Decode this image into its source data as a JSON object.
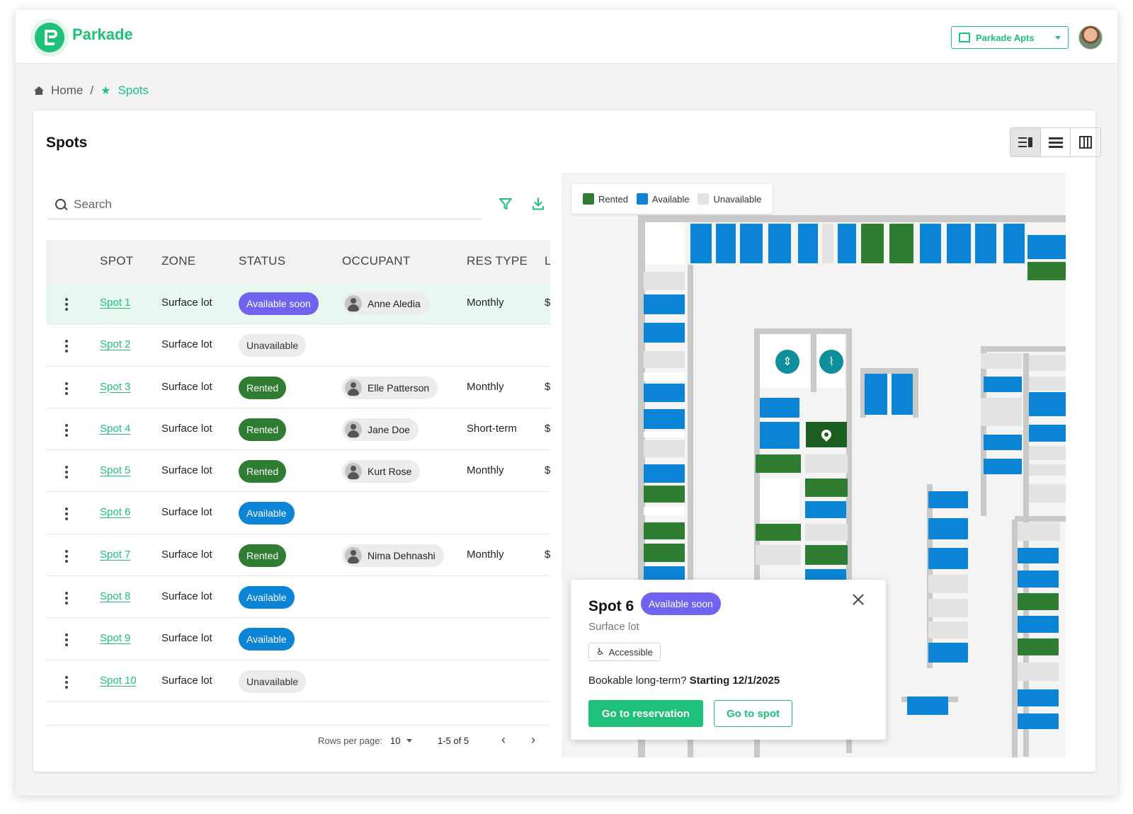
{
  "header": {
    "brand": "Parkade",
    "org_select": "Parkade Apts"
  },
  "breadcrumb": {
    "home": "Home",
    "separator": "/",
    "current": "Spots"
  },
  "page": {
    "title": "Spots"
  },
  "search": {
    "placeholder": "Search"
  },
  "table": {
    "columns": [
      "SPOT",
      "ZONE",
      "STATUS",
      "OCCUPANT",
      "RES TYPE",
      "L"
    ],
    "rows": [
      {
        "spot": "Spot 1",
        "zone": "Surface lot",
        "status": "Available soon",
        "status_kind": "soon",
        "occupant": "Anne Aledia",
        "res_type": "Monthly",
        "extra": "$",
        "selected": true
      },
      {
        "spot": "Spot 2",
        "zone": "Surface lot",
        "status": "Unavailable",
        "status_kind": "unavail",
        "occupant": "",
        "res_type": "",
        "extra": ""
      },
      {
        "spot": "Spot 3",
        "zone": "Surface lot",
        "status": "Rented",
        "status_kind": "rented",
        "occupant": "Elle Patterson",
        "res_type": "Monthly",
        "extra": "$"
      },
      {
        "spot": "Spot 4",
        "zone": "Surface lot",
        "status": "Rented",
        "status_kind": "rented",
        "occupant": "Jane Doe",
        "res_type": "Short-term",
        "extra": "$"
      },
      {
        "spot": "Spot 5",
        "zone": "Surface lot",
        "status": "Rented",
        "status_kind": "rented",
        "occupant": "Kurt Rose",
        "res_type": "Monthly",
        "extra": "$"
      },
      {
        "spot": "Spot 6",
        "zone": "Surface lot",
        "status": "Available",
        "status_kind": "available",
        "occupant": "",
        "res_type": "",
        "extra": ""
      },
      {
        "spot": "Spot 7",
        "zone": "Surface lot",
        "status": "Rented",
        "status_kind": "rented",
        "occupant": "Nima Dehnashi",
        "res_type": "Monthly",
        "extra": "$"
      },
      {
        "spot": "Spot 8",
        "zone": "Surface lot",
        "status": "Available",
        "status_kind": "available",
        "occupant": "",
        "res_type": "",
        "extra": ""
      },
      {
        "spot": "Spot 9",
        "zone": "Surface lot",
        "status": "Available",
        "status_kind": "available",
        "occupant": "",
        "res_type": "",
        "extra": ""
      },
      {
        "spot": "Spot 10",
        "zone": "Surface lot",
        "status": "Unavailable",
        "status_kind": "unavail",
        "occupant": "",
        "res_type": "",
        "extra": ""
      }
    ]
  },
  "pagination": {
    "rows_per_page_label": "Rows per page:",
    "rows_per_page_value": "10",
    "range": "1-5 of 5"
  },
  "map": {
    "legend": [
      {
        "label": "Rented",
        "color": "#2e7d32"
      },
      {
        "label": "Available",
        "color": "#0b84d6"
      },
      {
        "label": "Unavailable",
        "color": "#e3e3e3"
      }
    ]
  },
  "popup": {
    "title": "Spot 6",
    "status": "Available soon",
    "zone": "Surface lot",
    "tag": "Accessible",
    "long_term_label": "Bookable long-term?",
    "long_term_value": "Starting 12/1/2025",
    "primary_button": "Go to reservation",
    "secondary_button": "Go to spot"
  },
  "colors": {
    "brand": "#1ec07a",
    "rented": "#2e7d32",
    "available": "#0b84d6",
    "available_soon": "#6f63f0",
    "unavailable": "#ececec"
  },
  "icons": [
    "home-icon",
    "star-icon",
    "search-icon",
    "filter-icon",
    "download-icon",
    "kebab-icon",
    "person-icon",
    "elevator-icon",
    "stairs-icon",
    "location-pin-icon",
    "close-icon",
    "accessible-icon",
    "split-view-icon",
    "list-view-icon",
    "map-view-icon",
    "building-icon",
    "chevron-left-icon",
    "chevron-right-icon"
  ]
}
